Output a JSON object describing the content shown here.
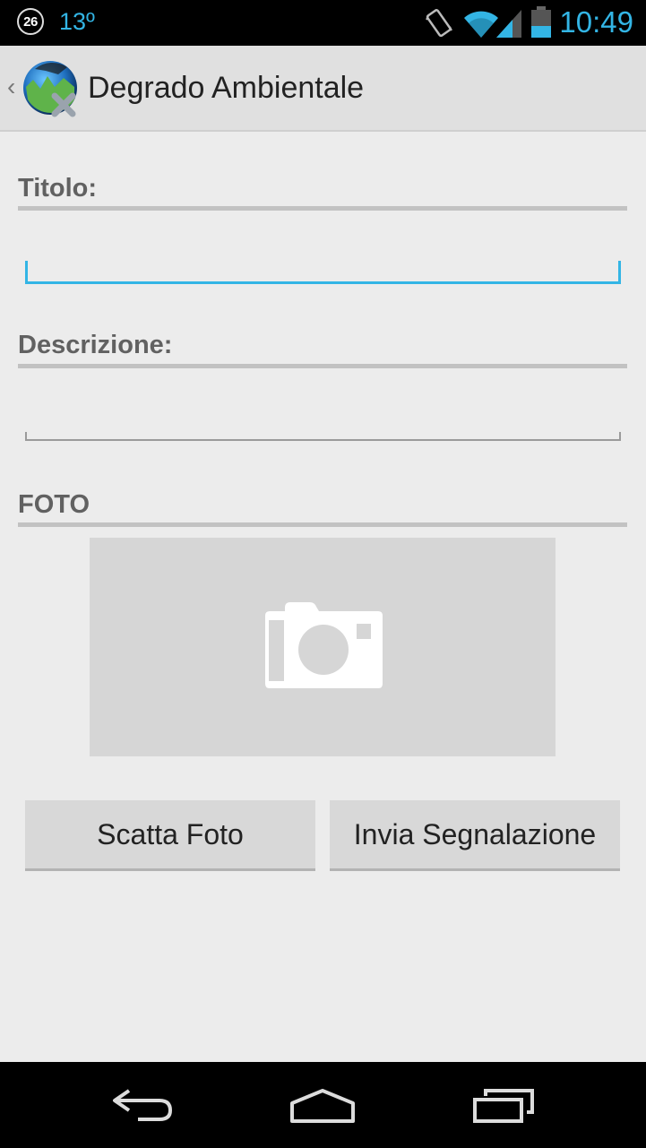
{
  "status_bar": {
    "notification_count": "26",
    "temperature": "13º",
    "time": "10:49",
    "icons": [
      "vibrate-icon",
      "wifi-icon",
      "signal-icon",
      "battery-icon"
    ],
    "accent_color": "#33b5e5"
  },
  "action_bar": {
    "title": "Degrado Ambientale",
    "icons": [
      "up-chevron-icon",
      "app-logo-icon"
    ]
  },
  "form": {
    "title_label": "Titolo:",
    "title_value": "",
    "description_label": "Descrizione:",
    "description_value": "",
    "photo_label": "FOTO",
    "photo_placeholder_icon": "camera-icon"
  },
  "buttons": {
    "take_photo": "Scatta Foto",
    "send_report": "Invia Segnalazione"
  },
  "nav_bar": {
    "icons": [
      "back-icon",
      "home-icon",
      "recents-icon"
    ]
  }
}
